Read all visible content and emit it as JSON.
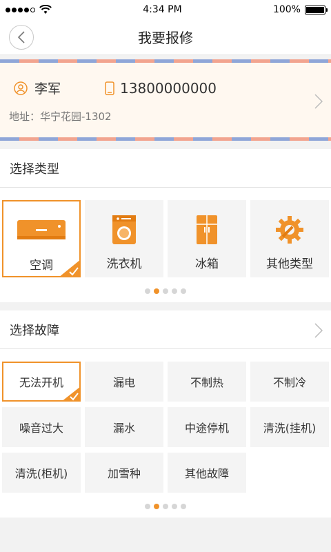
{
  "status_bar": {
    "time": "4:34 PM",
    "battery": "100%"
  },
  "header": {
    "title": "我要报修"
  },
  "address": {
    "name": "李军",
    "phone": "13800000000",
    "address_line": "地址：华宁花园-1302"
  },
  "category_section": {
    "title": "选择类型",
    "items": [
      {
        "label": "空调",
        "icon": "air-conditioner-icon",
        "selected": true
      },
      {
        "label": "洗衣机",
        "icon": "washing-machine-icon",
        "selected": false
      },
      {
        "label": "冰箱",
        "icon": "refrigerator-icon",
        "selected": false
      },
      {
        "label": "其他类型",
        "icon": "gear-wrench-icon",
        "selected": false
      }
    ],
    "pager": {
      "pages": 5,
      "current": 2
    }
  },
  "fault_section": {
    "title": "选择故障",
    "items": [
      {
        "label": "无法开机",
        "selected": true
      },
      {
        "label": "漏电",
        "selected": false
      },
      {
        "label": "不制热",
        "selected": false
      },
      {
        "label": "不制冷",
        "selected": false
      },
      {
        "label": "噪音过大",
        "selected": false
      },
      {
        "label": "漏水",
        "selected": false
      },
      {
        "label": "中途停机",
        "selected": false
      },
      {
        "label": "清洗(挂机)",
        "selected": false
      },
      {
        "label": "清洗(柜机)",
        "selected": false
      },
      {
        "label": "加雪种",
        "selected": false
      },
      {
        "label": "其他故障",
        "selected": false
      }
    ],
    "pager": {
      "pages": 5,
      "current": 2
    }
  },
  "colors": {
    "accent": "#f0922a",
    "airmail_blue": "#8fa6d8",
    "airmail_red": "#f2a48f"
  }
}
